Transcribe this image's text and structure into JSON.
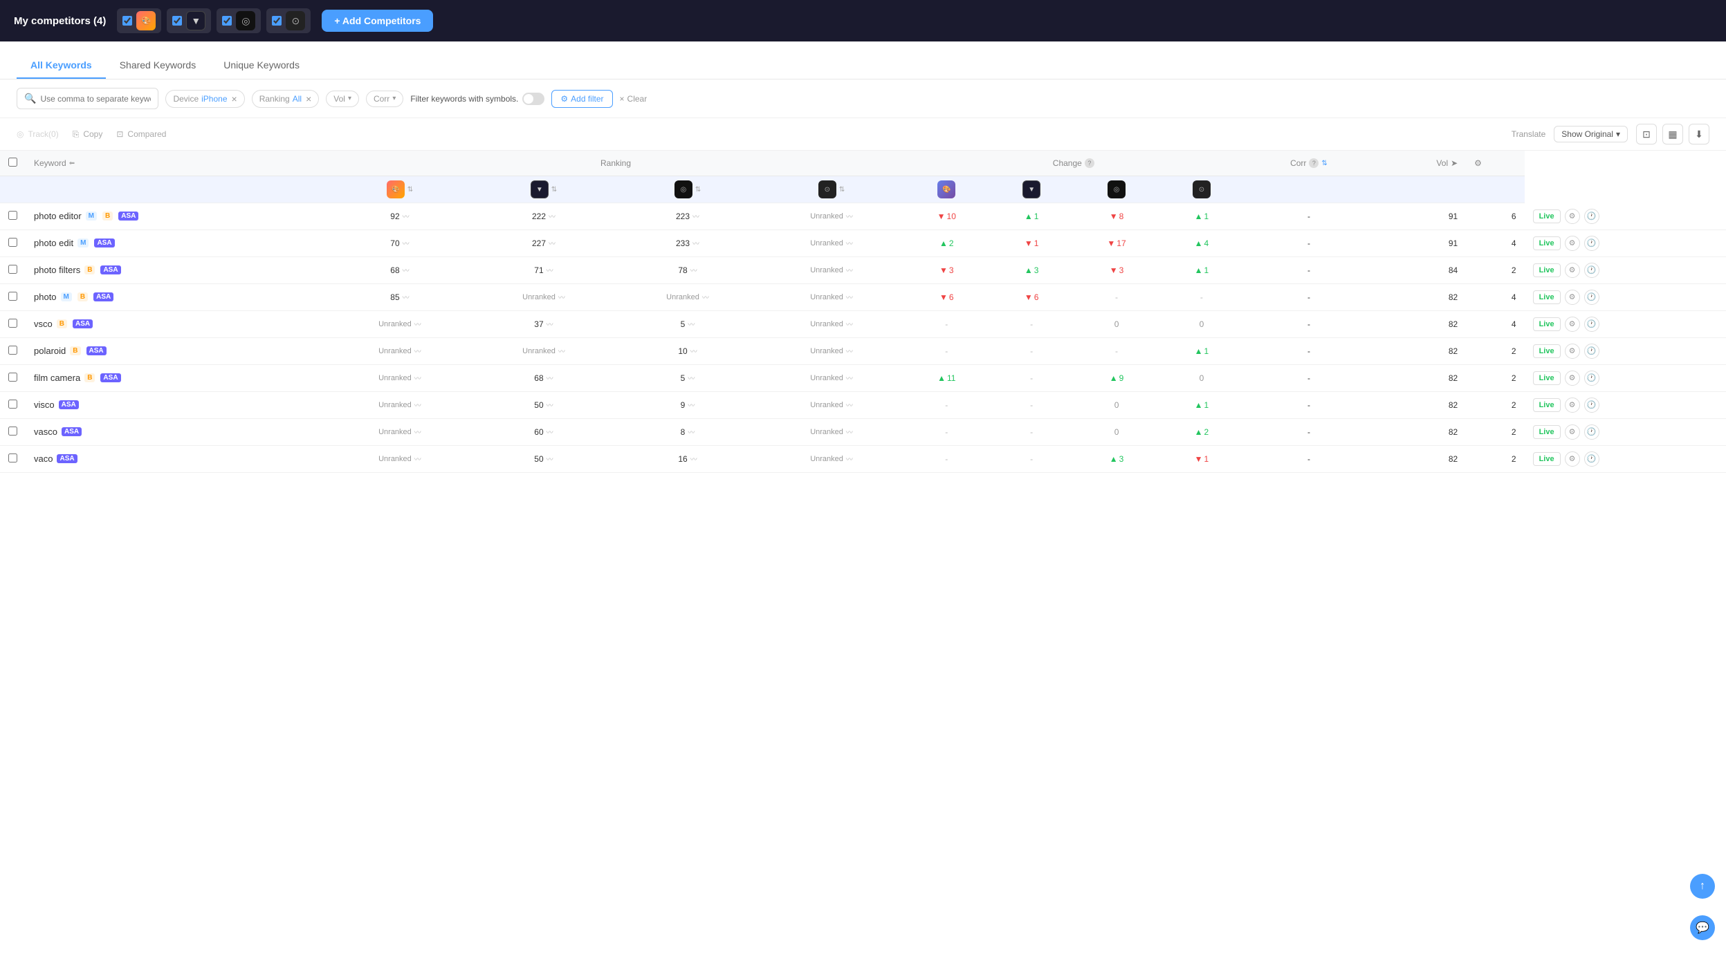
{
  "header": {
    "title": "My competitors",
    "count": "4",
    "add_button": "+ Add Competitors",
    "competitors": [
      {
        "id": 1,
        "checked": true,
        "icon_class": "app-icon-1",
        "glyph": "🎨"
      },
      {
        "id": 2,
        "checked": true,
        "icon_class": "app-icon-2",
        "glyph": "▼"
      },
      {
        "id": 3,
        "checked": true,
        "icon_class": "app-icon-3",
        "glyph": "◎"
      },
      {
        "id": 4,
        "checked": true,
        "icon_class": "app-icon-4",
        "glyph": "⊙"
      }
    ]
  },
  "tabs": [
    {
      "label": "All Keywords",
      "active": true
    },
    {
      "label": "Shared Keywords",
      "active": false
    },
    {
      "label": "Unique Keywords",
      "active": false
    }
  ],
  "filters": {
    "search_placeholder": "Use comma to separate keywords",
    "device_label": "Device",
    "device_value": "iPhone",
    "ranking_label": "Ranking",
    "ranking_value": "All",
    "vol_label": "Vol",
    "corr_label": "Corr",
    "filter_keywords_label": "Filter keywords with symbols.",
    "add_filter": "Add filter",
    "clear": "Clear"
  },
  "toolbar": {
    "track_label": "Track(0)",
    "copy_label": "Copy",
    "compared_label": "Compared",
    "translate_label": "Translate",
    "show_original_label": "Show Original"
  },
  "table": {
    "col_keyword": "Keyword",
    "col_ranking": "Ranking",
    "col_change": "Change",
    "col_corr": "Corr",
    "col_vol": "Vol",
    "rows": [
      {
        "keyword": "photo editor",
        "badges": [
          "M",
          "B",
          "ASA"
        ],
        "rankings": [
          "92",
          "222",
          "223",
          "Unranked"
        ],
        "changes": [
          {
            "type": "down",
            "val": "10"
          },
          {
            "type": "up",
            "val": "1"
          },
          {
            "type": "down",
            "val": "8"
          },
          {
            "type": "up",
            "val": "1"
          }
        ],
        "corr": "-",
        "vol": "91",
        "vol2": "6"
      },
      {
        "keyword": "photo edit",
        "badges": [
          "M",
          "ASA"
        ],
        "rankings": [
          "70",
          "227",
          "233",
          "Unranked"
        ],
        "changes": [
          {
            "type": "up",
            "val": "2"
          },
          {
            "type": "down",
            "val": "1"
          },
          {
            "type": "down",
            "val": "17"
          },
          {
            "type": "up",
            "val": "4"
          }
        ],
        "corr": "-",
        "vol": "91",
        "vol2": "4"
      },
      {
        "keyword": "photo filters",
        "badges": [
          "B",
          "ASA"
        ],
        "rankings": [
          "68",
          "71",
          "78",
          "Unranked"
        ],
        "changes": [
          {
            "type": "down",
            "val": "3"
          },
          {
            "type": "up",
            "val": "3"
          },
          {
            "type": "down",
            "val": "3"
          },
          {
            "type": "up",
            "val": "1"
          }
        ],
        "corr": "-",
        "vol": "84",
        "vol2": "2"
      },
      {
        "keyword": "photo",
        "badges": [
          "M",
          "B",
          "ASA"
        ],
        "rankings": [
          "85",
          "Unranked",
          "Unranked",
          "Unranked"
        ],
        "changes": [
          {
            "type": "down",
            "val": "6"
          },
          {
            "type": "down",
            "val": "6"
          },
          {
            "type": "dash",
            "val": "-"
          },
          {
            "type": "dash",
            "val": "-"
          }
        ],
        "corr": "-",
        "vol": "82",
        "vol2": "4"
      },
      {
        "keyword": "vsco",
        "badges": [
          "B",
          "ASA"
        ],
        "rankings": [
          "Unranked",
          "37",
          "5",
          "Unranked"
        ],
        "changes": [
          {
            "type": "dash",
            "val": "-"
          },
          {
            "type": "dash",
            "val": "-"
          },
          {
            "type": "zero",
            "val": "0"
          },
          {
            "type": "zero",
            "val": "0"
          }
        ],
        "corr": "-",
        "vol": "82",
        "vol2": "4"
      },
      {
        "keyword": "polaroid",
        "badges": [
          "B",
          "ASA"
        ],
        "rankings": [
          "Unranked",
          "Unranked",
          "10",
          "Unranked"
        ],
        "changes": [
          {
            "type": "dash",
            "val": "-"
          },
          {
            "type": "dash",
            "val": "-"
          },
          {
            "type": "dash",
            "val": "-"
          },
          {
            "type": "up",
            "val": "1"
          }
        ],
        "corr": "-",
        "vol": "82",
        "vol2": "2"
      },
      {
        "keyword": "film camera",
        "badges": [
          "B",
          "ASA"
        ],
        "rankings": [
          "Unranked",
          "68",
          "5",
          "Unranked"
        ],
        "changes": [
          {
            "type": "up",
            "val": "11"
          },
          {
            "type": "dash",
            "val": "-"
          },
          {
            "type": "up",
            "val": "9"
          },
          {
            "type": "zero",
            "val": "0"
          }
        ],
        "corr": "-",
        "vol": "82",
        "vol2": "2"
      },
      {
        "keyword": "visco",
        "badges": [
          "ASA"
        ],
        "rankings": [
          "Unranked",
          "50",
          "9",
          "Unranked"
        ],
        "changes": [
          {
            "type": "dash",
            "val": "-"
          },
          {
            "type": "dash",
            "val": "-"
          },
          {
            "type": "zero",
            "val": "0"
          },
          {
            "type": "up",
            "val": "1"
          }
        ],
        "corr": "-",
        "vol": "82",
        "vol2": "2"
      },
      {
        "keyword": "vasco",
        "badges": [
          "ASA"
        ],
        "rankings": [
          "Unranked",
          "60",
          "8",
          "Unranked"
        ],
        "changes": [
          {
            "type": "dash",
            "val": "-"
          },
          {
            "type": "dash",
            "val": "-"
          },
          {
            "type": "zero",
            "val": "0"
          },
          {
            "type": "up",
            "val": "2"
          }
        ],
        "corr": "-",
        "vol": "82",
        "vol2": "2"
      },
      {
        "keyword": "vaco",
        "badges": [
          "ASA"
        ],
        "rankings": [
          "Unranked",
          "50",
          "16",
          "Unranked"
        ],
        "changes": [
          {
            "type": "dash",
            "val": "-"
          },
          {
            "type": "dash",
            "val": "-"
          },
          {
            "type": "up",
            "val": "3"
          },
          {
            "type": "down",
            "val": "1"
          }
        ],
        "corr": "-",
        "vol": "82",
        "vol2": "2"
      }
    ]
  }
}
